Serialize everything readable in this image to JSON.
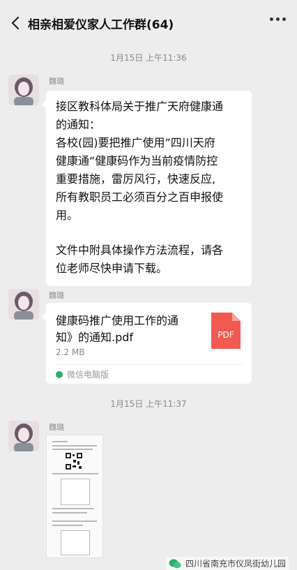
{
  "header": {
    "title": "相亲相爱仪家人工作群(64)"
  },
  "messages": [
    {
      "type": "timestamp",
      "text": "1月15日 上午11:36"
    },
    {
      "type": "text",
      "sender": "魏璐",
      "lines": [
        "接区教科体局关于推广天府健康通",
        "的通知：",
        "各校(园)要把推广使用”四川天府",
        "健康通“健康码作为当前疫情防控",
        "重要措施，雷厉风行，快速反应,",
        "所有教职员工必须百分之百申报使",
        "用。",
        "",
        "文件中附具体操作方法流程，请各",
        "位老师尽快申请下载。"
      ]
    },
    {
      "type": "file",
      "sender": "魏璐",
      "file_name_lines": [
        "健康码推广使用工作的通",
        "知》的通知.pdf"
      ],
      "file_size": "2.2 MB",
      "source": "微信电脑版",
      "icon_label": "PDF"
    },
    {
      "type": "timestamp",
      "text": "1月15日 上午11:37"
    },
    {
      "type": "image",
      "sender": "魏璐"
    }
  ],
  "watermark": "四川省南充市仪凤街幼儿园",
  "colors": {
    "background": "#ededed",
    "bubble": "#ffffff",
    "pdf_red": "#f05a50",
    "wechat_green": "#2bae67"
  },
  "icons": [
    "back-icon",
    "more-icon",
    "pdf-file-icon",
    "wechat-icon"
  ]
}
